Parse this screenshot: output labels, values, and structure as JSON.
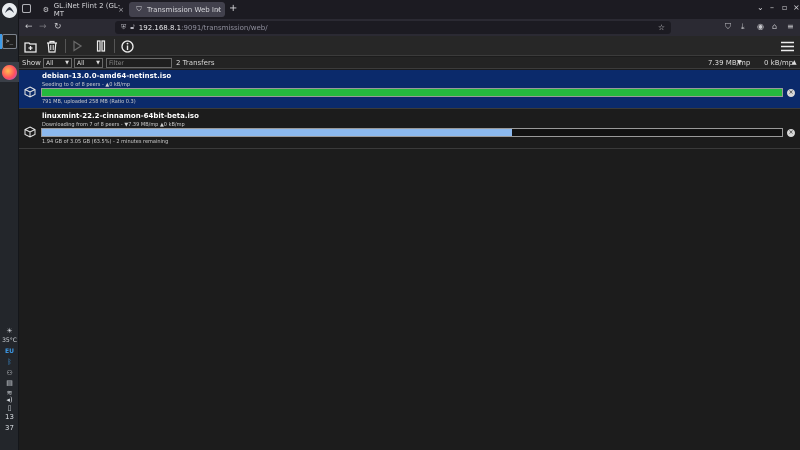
{
  "browser": {
    "tabs": [
      {
        "title": "GL.iNet Flint 2 (GL-MT",
        "active": false
      },
      {
        "title": "Transmission Web Int",
        "active": true
      }
    ],
    "new_tab": "+",
    "url_host": "192.168.8.1",
    "url_rest": ":9091/transmission/web/"
  },
  "dock": {
    "temperature": "35°C",
    "keyboard_layout": "EU",
    "clock_hour": "13",
    "clock_minute": "37"
  },
  "transmission": {
    "filter": {
      "show_label": "Show",
      "status_select": "All",
      "tracker_select": "All",
      "filter_placeholder": "Filter",
      "transfer_count": "2 Transfers",
      "total_down": "7.39 MB/mp",
      "total_up": "0 kB/mp"
    },
    "torrents": [
      {
        "name": "debian-13.0.0-amd64-netinst.iso",
        "peers": "Seeding to 0 of 8 peers - ▲0 kB/mp",
        "details": "791 MB, uploaded 258 MB (Ratio 0.3)",
        "progress": 1.0,
        "color": "#25b93e",
        "selected": true
      },
      {
        "name": "linuxmint-22.2-cinnamon-64bit-beta.iso",
        "peers": "Downloading from 7 of 8 peers - ▼7.39 MB/mp ▲0 kB/mp",
        "details": "1.94 GB of 3.05 GB (63.5%) - 2 minutes remaining",
        "progress": 0.635,
        "color": "#8cb9ee",
        "selected": false
      }
    ]
  }
}
